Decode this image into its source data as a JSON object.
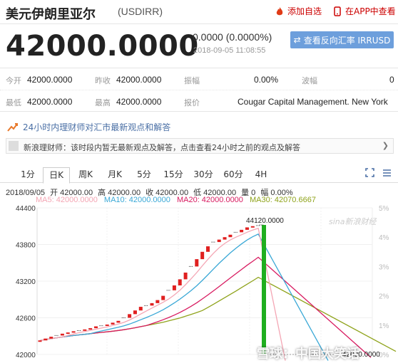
{
  "header": {
    "title": "美元伊朗里亚尔",
    "code": "(USDIRR)",
    "add_fav": "添加自选",
    "in_app": "在APP中查看"
  },
  "quote": {
    "price": "42000.0000",
    "change": "0.0000 (0.0000%)",
    "time": "2018-09-05 11:08:55",
    "reverse_button": "查看反向汇率 IRRUSD"
  },
  "stats": {
    "open_label": "今开",
    "open": "42000.0000",
    "prev_label": "昨收",
    "prev": "42000.0000",
    "amp_label": "振幅",
    "amp": "0.00%",
    "wave_label": "波幅",
    "wave": "0",
    "low_label": "最低",
    "low": "42000.0000",
    "high_label": "最高",
    "high": "42000.0000",
    "quote_label": "报价",
    "quote_src": "Cougar Capital Management. New York"
  },
  "advice": {
    "heading": "24小时内理财师对汇市最新观点和解答",
    "message": "新浪理财师：该时段内暂无最新观点及解答，点击查看24小时之前的观点及解答"
  },
  "tabs": [
    "1分",
    "日K",
    "周K",
    "月K",
    "5分",
    "15分",
    "30分",
    "60分",
    "4H"
  ],
  "active_tab": "日K",
  "kline_info": {
    "date": "2018/09/05",
    "open": "开 42000.00",
    "high": "高 42000.00",
    "close": "收 42000.00",
    "low": "低 42000.00",
    "volume": "量 0",
    "pct": "幅 0.00%"
  },
  "ma_legend": [
    {
      "label": "MA5: 42000.0000",
      "color": "#f4a6b4"
    },
    {
      "label": "MA10: 42000.0000",
      "color": "#3aa8d6"
    },
    {
      "label": "MA20: 42000.0000",
      "color": "#d81b60"
    },
    {
      "label": "MA30: 42070.6667",
      "color": "#8fa31b"
    }
  ],
  "sina_mark": "sina新浪财经",
  "watermark": "雪球：中国大笑话",
  "chart_data": {
    "type": "candlestick",
    "y_ticks": [
      "44400",
      "43800",
      "43200",
      "42600",
      "42000"
    ],
    "y_right_ticks": [
      "5%",
      "4%",
      "3%",
      "2%",
      "1%",
      "0%"
    ],
    "ylim": [
      42000,
      44400
    ],
    "max_label": "44120.0000",
    "min_label": "42000.0000",
    "closes": [
      42230,
      42260,
      42290,
      42310,
      42340,
      42360,
      42380,
      42390,
      42410,
      42430,
      42460,
      42470,
      42490,
      42520,
      42550,
      42600,
      42660,
      42720,
      42780,
      42800,
      42840,
      42890,
      42960,
      43050,
      43130,
      43230,
      43340,
      43440,
      43560,
      43680,
      43770,
      43840,
      43880,
      43920,
      43960,
      44000,
      44040,
      44080,
      44100,
      44110,
      42000
    ]
  }
}
